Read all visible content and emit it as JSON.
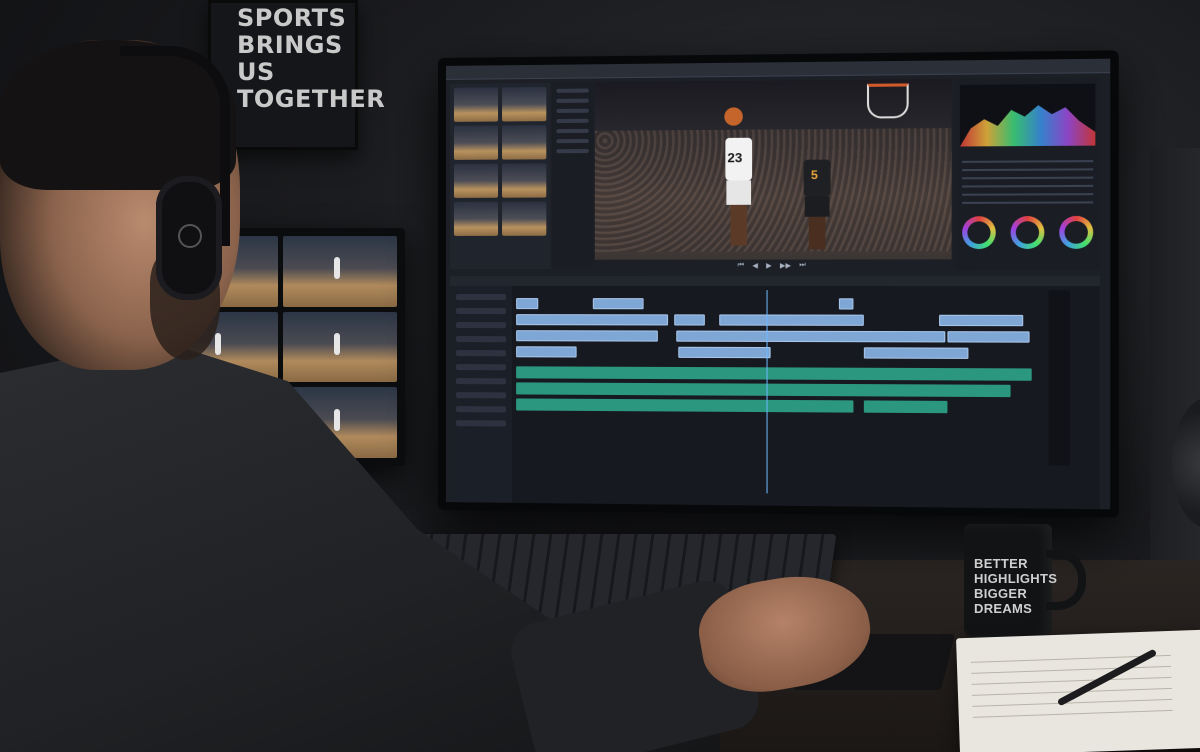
{
  "poster": {
    "lines": [
      "SPORTS",
      "BRINGS",
      "US",
      "TOGETHER"
    ]
  },
  "mug": {
    "lines": [
      "BETTER",
      "HIGHLIGHTS",
      "BIGGER",
      "DREAMS"
    ]
  },
  "viewer": {
    "player_white_number": "23",
    "player_dark_number": "5",
    "controls": [
      "⏮",
      "◀",
      "▶",
      "▶▶",
      "⏭"
    ]
  },
  "colors": {
    "video_clip": "#7fa7d6",
    "audio_clip": "#2fa58a",
    "playhead": "#6db8ff"
  },
  "icons": {
    "headphones": "headphones-icon",
    "color_wheel": "color-wheel-icon"
  }
}
